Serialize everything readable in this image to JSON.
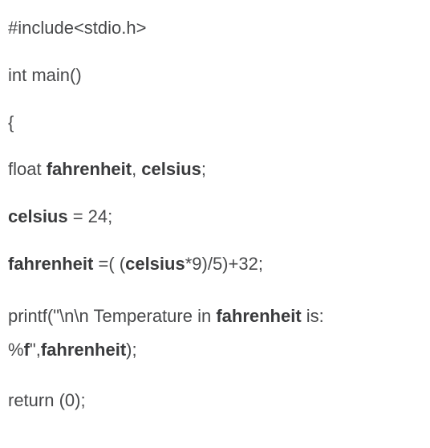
{
  "code": {
    "line1": "#include<stdio.h>",
    "line2": "int main()",
    "line3": "{",
    "line4_1": "float ",
    "line4_2": "fahrenheit",
    "line4_3": ", ",
    "line4_4": "celsius",
    "line4_5": ";",
    "line5_1": "celsius",
    "line5_2": " = 24;",
    "line6_1": "fahrenheit",
    "line6_2": " =( (",
    "line6_3": "celsius",
    "line6_4": "*9)/5)+32;",
    "line7_1": "printf(\"\\n\\n Temperature in ",
    "line7_2": "fahrenheit",
    "line7_3": " is: %",
    "line7_4": "f",
    "line7_5": "\",",
    "line7_6": "fahrenheit",
    "line7_7": ");",
    "line8": "return (0);"
  }
}
